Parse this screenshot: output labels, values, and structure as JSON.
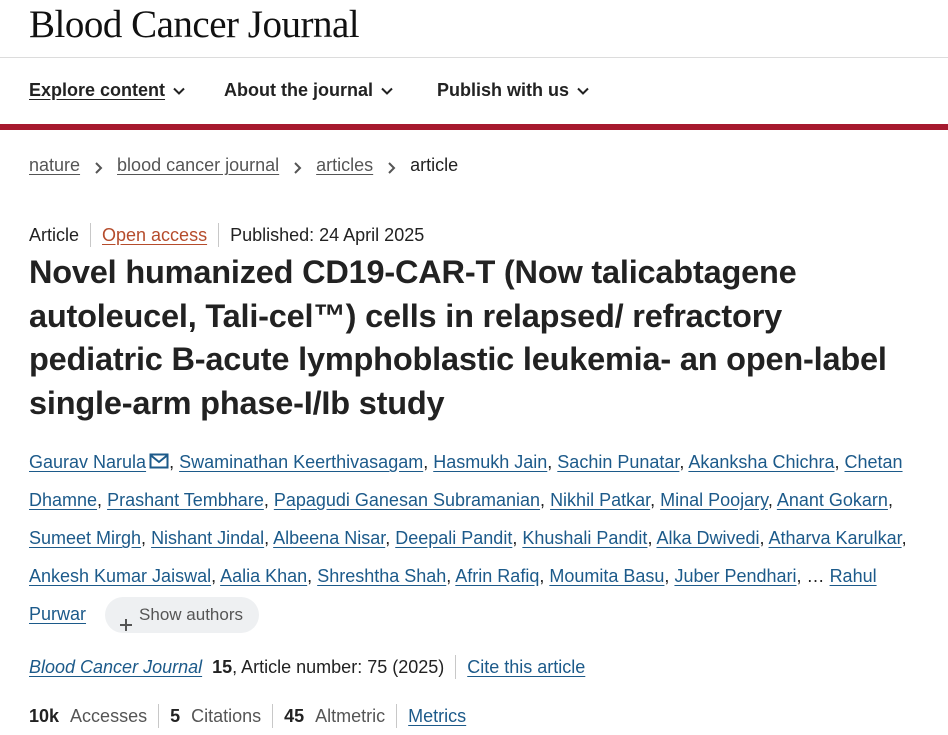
{
  "journal": {
    "title": "Blood Cancer Journal"
  },
  "nav": {
    "items": [
      {
        "label": "Explore content"
      },
      {
        "label": "About the journal"
      },
      {
        "label": "Publish with us"
      }
    ]
  },
  "breadcrumb": {
    "items": [
      {
        "label": "nature"
      },
      {
        "label": "blood cancer journal"
      },
      {
        "label": "articles"
      }
    ],
    "current": "article"
  },
  "article": {
    "type": "Article",
    "access": "Open access",
    "published": "Published: 24 April 2025",
    "title": "Novel humanized CD19-CAR-T (Now talicabtagene autoleucel, Tali-cel™) cells in relapsed/ refractory pediatric B-acute lymphoblastic leukemia- an open-label single-arm phase-I/Ib study"
  },
  "authors": {
    "names": [
      "Gaurav Narula",
      "Swaminathan Keerthivasagam",
      "Hasmukh Jain",
      "Sachin Punatar",
      "Akanksha Chichra",
      "Chetan Dhamne",
      "Prashant Tembhare",
      "Papagudi Ganesan Subramanian",
      "Nikhil Patkar",
      "Minal Poojary",
      "Anant Gokarn",
      "Sumeet Mirgh",
      "Nishant Jindal",
      "Albeena Nisar",
      "Deepali Pandit",
      "Khushali Pandit",
      "Alka Dwivedi",
      "Atharva Karulkar",
      "Ankesh Kumar Jaiswal",
      "Aalia Khan",
      "Shreshtha Shah",
      "Afrin Rafiq",
      "Moumita Basu",
      "Juber Pendhari"
    ],
    "ellipsis": "…",
    "last_author": "Rahul Purwar",
    "show_authors_label": "Show authors"
  },
  "citation": {
    "journal": "Blood Cancer Journal",
    "volume": "15",
    "article_number": ", Article number: 75 (2025)",
    "cite_label": "Cite this article"
  },
  "metrics": {
    "accesses_value": "10k",
    "accesses_label": "Accesses",
    "citations_value": "5",
    "citations_label": "Citations",
    "altmetric_value": "45",
    "altmetric_label": "Altmetric",
    "metrics_link": "Metrics"
  },
  "colors": {
    "brand_rule": "#a6192e",
    "link": "#1c5a8a",
    "open_access": "#b54c2c"
  }
}
